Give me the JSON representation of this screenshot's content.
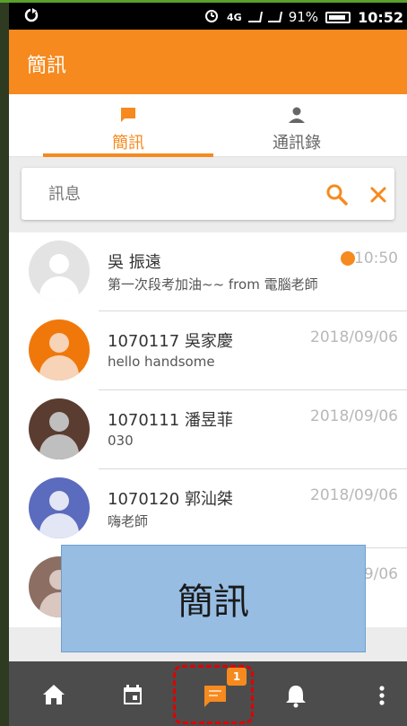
{
  "status_bar": {
    "battery": "91%",
    "time": "10:52",
    "network": "4G"
  },
  "app_bar": {
    "title": "簡訊"
  },
  "tabs": [
    {
      "label": "簡訊",
      "icon": "message-icon",
      "active": true
    },
    {
      "label": "通訊錄",
      "icon": "person-icon",
      "active": false
    }
  ],
  "search": {
    "placeholder": "訊息"
  },
  "conversations": [
    {
      "name": "吳 振遠",
      "preview": "第一次段考加油~~ from 電腦老師",
      "date": "10:50",
      "unread": true,
      "avatar_bg": "#e3e3e3",
      "avatar_fg": "#ffffff"
    },
    {
      "name": "1070117 吳家慶",
      "preview": "hello handsome",
      "date": "2018/09/06",
      "unread": false,
      "avatar_bg": "#f0780a",
      "avatar_fg": "#f7d3b8"
    },
    {
      "name": "1070111 潘昱菲",
      "preview": "030",
      "date": "2018/09/06",
      "unread": false,
      "avatar_bg": "#5a3c31",
      "avatar_fg": "#bfbfbf"
    },
    {
      "name": "1070120 郭汕桀",
      "preview": "嗨老師",
      "date": "2018/09/06",
      "unread": false,
      "avatar_bg": "#5b6bbd",
      "avatar_fg": "#e3e6f5"
    },
    {
      "name": "",
      "preview": "",
      "date": "9/06",
      "unread": false,
      "avatar_bg": "#8d6e63",
      "avatar_fg": "#d9c7c0"
    }
  ],
  "overlay": {
    "label": "簡訊"
  },
  "bottom_nav": {
    "items": [
      "home-icon",
      "calendar-icon",
      "message-icon",
      "bell-icon",
      "more-vert-icon"
    ],
    "badge": "1"
  },
  "colors": {
    "primary": "#f68a1e",
    "nav_bg": "#4c4c4c",
    "highlight": "#e00000"
  }
}
